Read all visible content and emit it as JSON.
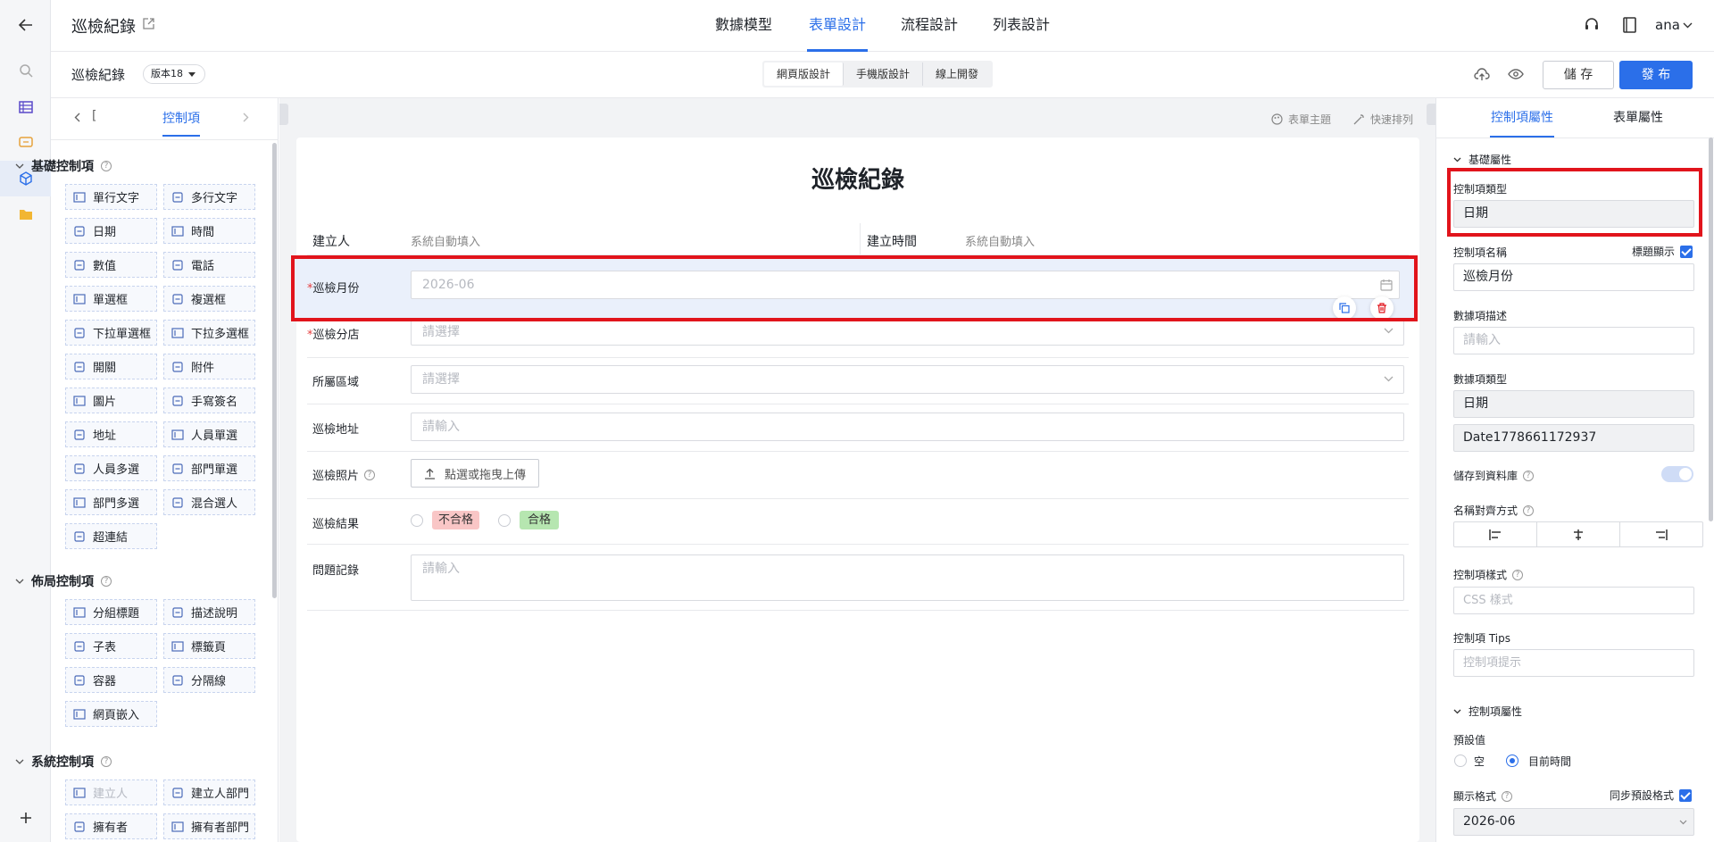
{
  "app": {
    "title": "巡檢紀錄"
  },
  "header": {
    "tabs": [
      {
        "label": "數據模型"
      },
      {
        "label": "表單設計"
      },
      {
        "label": "流程設計"
      },
      {
        "label": "列表設計"
      }
    ],
    "active_tab": "表單設計",
    "user": "ana"
  },
  "subbar": {
    "form_name": "巡檢紀錄",
    "version": "版本18",
    "segments": [
      {
        "label": "網頁版設計"
      },
      {
        "label": "手機版設計"
      },
      {
        "label": "線上開發"
      }
    ],
    "save_label": "儲 存",
    "publish_label": "發 布"
  },
  "left_panel": {
    "tab_left": "[",
    "tab_active": "控制項",
    "sections": [
      {
        "title": "基礎控制項",
        "items": [
          "單行文字",
          "多行文字",
          "日期",
          "時間",
          "數值",
          "電話",
          "單選框",
          "複選框",
          "下拉單選框",
          "下拉多選框",
          "開關",
          "附件",
          "圖片",
          "手寫簽名",
          "地址",
          "人員單選",
          "人員多選",
          "部門單選",
          "部門多選",
          "混合選人",
          "超連結"
        ]
      },
      {
        "title": "佈局控制項",
        "items": [
          "分組標題",
          "描述說明",
          "子表",
          "標籤頁",
          "容器",
          "分隔線",
          "網頁嵌入"
        ]
      },
      {
        "title": "系統控制項",
        "items": [
          "建立人",
          "建立人部門",
          "擁有者",
          "擁有者部門"
        ]
      }
    ]
  },
  "canvas": {
    "toolbar": {
      "theme": "表單主題",
      "arrange": "快速排列"
    },
    "form_title": "巡檢紀錄",
    "creator_label": "建立人",
    "creator_value": "系統自動填入",
    "created_time_label": "建立時間",
    "created_time_value": "系統自動填入",
    "fields": {
      "month": {
        "label": "巡檢月份",
        "value": "2026-06"
      },
      "store": {
        "label": "巡檢分店",
        "placeholder": "請選擇"
      },
      "region": {
        "label": "所屬區域",
        "placeholder": "請選擇"
      },
      "address": {
        "label": "巡檢地址",
        "placeholder": "請輸入"
      },
      "photo": {
        "label": "巡檢照片",
        "upload_label": "點選或拖曳上傳"
      },
      "result": {
        "label": "巡檢結果",
        "options": [
          "不合格",
          "合格"
        ]
      },
      "issue": {
        "label": "問題記錄",
        "placeholder": "請輸入"
      }
    }
  },
  "right_panel": {
    "tabs": [
      {
        "label": "控制項屬性"
      },
      {
        "label": "表單屬性"
      }
    ],
    "basic_section": "基礎屬性",
    "control_type_label": "控制項類型",
    "control_type_value": "日期",
    "control_name_label": "控制項名稱",
    "title_display_label": "標題顯示",
    "control_name_value": "巡檢月份",
    "data_desc_label": "數據項描述",
    "data_desc_placeholder": "請輸入",
    "data_type_label": "數據項類型",
    "data_type_value": "日期",
    "data_id_value": "Date1778661172937",
    "save_db_label": "儲存到資料庫",
    "align_label": "名稱對齊方式",
    "style_label": "控制項樣式",
    "style_placeholder": "CSS 樣式",
    "tips_label": "控制項 Tips",
    "tips_placeholder": "控制項提示",
    "ctrl_section": "控制項屬性",
    "default_label": "預設值",
    "default_options": [
      "空",
      "目前時間"
    ],
    "format_label": "顯示格式",
    "sync_label": "同步預設格式",
    "format_value": "2026-06"
  },
  "colors": {
    "accent": "#2b6fe9",
    "highlight": "#e1141c",
    "fail_tag": "#f9c6c6",
    "pass_tag": "#b6e6b0"
  }
}
